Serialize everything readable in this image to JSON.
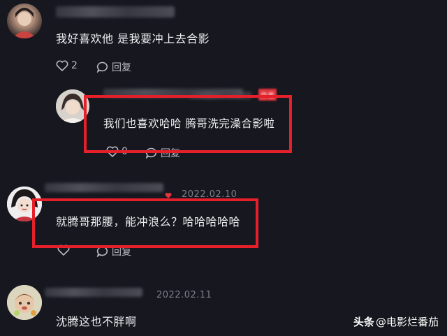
{
  "comments": [
    {
      "text": "我好喜欢他 是我要冲上去合影",
      "likes": "2",
      "reply_label": "回复"
    },
    {
      "text": "我们也喜欢哈哈 腾哥洗完澡合影啦",
      "likes": "0",
      "reply_label": "回复",
      "badge": "作者"
    },
    {
      "date": "2022.02.10",
      "text": "就腾哥那腰，能冲浪么？哈哈哈哈哈",
      "reply_label": "回复"
    },
    {
      "date": "2022.02.11",
      "text": "沈腾这也不胖啊"
    }
  ],
  "watermark": {
    "brand": "头条",
    "handle": "@电影烂番茄"
  },
  "colors": {
    "background": "#16171f",
    "highlight_box": "#e5202a",
    "text": "#eeeef0",
    "muted": "#7d7e88"
  }
}
